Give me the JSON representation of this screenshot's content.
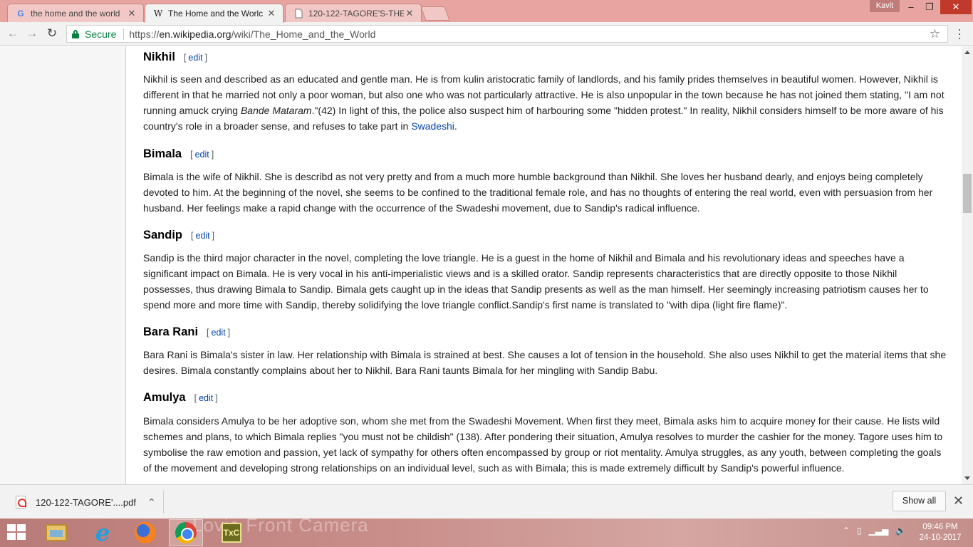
{
  "browser": {
    "tabs": [
      {
        "title": "the home and the world",
        "icon": "google-icon",
        "active": false
      },
      {
        "title": "The Home and the Worlc",
        "icon": "wikipedia-icon",
        "active": true
      },
      {
        "title": "120-122-TAGORE'S-THE-",
        "icon": "document-icon",
        "active": false
      }
    ],
    "user_name": "Kavit",
    "window_controls": {
      "minimize": "–",
      "restore": "❐",
      "close": "✕"
    },
    "nav": {
      "back": "←",
      "forward": "→",
      "reload": "↻"
    },
    "address": {
      "secure_label": "Secure",
      "scheme": "https://",
      "host": "en.wikipedia.org",
      "path": "/wiki/The_Home_and_the_World"
    }
  },
  "article": {
    "edit_label": "edit",
    "sections": [
      {
        "heading": "Nikhil",
        "paragraph": {
          "t1": "Nikhil is seen and described as an educated and gentle man. He is from kulin aristocratic family of landlords, and his family prides themselves in beautiful women. However, Nikhil is different in that he married not only a poor woman, but also one who was not particularly attractive. He is also unpopular in the town because he has not joined them stating, \"I am not running amuck crying ",
          "italic": "Bande Mataram",
          "t2": ".\"(42) In light of this, the police also suspect him of harbouring some \"hidden protest.\" In reality, Nikhil considers himself to be more aware of his country's role in a broader sense, and refuses to take part in ",
          "link": "Swadeshi",
          "t3": "."
        }
      },
      {
        "heading": "Bimala",
        "paragraph": "Bimala is the wife of Nikhil. She is describd as not very pretty and from a much more humble background than Nikhil. She loves her husband dearly, and enjoys being completely devoted to him. At the beginning of the novel, she seems to be confined to the traditional female role, and has no thoughts of entering the real world, even with persuasion from her husband. Her feelings make a rapid change with the occurrence of the Swadeshi movement, due to Sandip's radical influence."
      },
      {
        "heading": "Sandip",
        "paragraph": "Sandip is the third major character in the novel, completing the love triangle. He is a guest in the home of Nikhil and Bimala and his revolutionary ideas and speeches have a significant impact on Bimala. He is very vocal in his anti-imperialistic views and is a skilled orator. Sandip represents characteristics that are directly opposite to those Nikhil possesses, thus drawing Bimala to Sandip. Bimala gets caught up in the ideas that Sandip presents as well as the man himself. Her seemingly increasing patriotism causes her to spend more and more time with Sandip, thereby solidifying the love triangle conflict.Sandip's first name is translated to \"with dipa (light fire flame)\"."
      },
      {
        "heading": "Bara Rani",
        "paragraph": "Bara Rani is Bimala's sister in law. Her relationship with Bimala is strained at best. She causes a lot of tension in the household. She also uses Nikhil to get the material items that she desires. Bimala constantly complains about her to Nikhil. Bara Rani taunts Bimala for her mingling with Sandip Babu."
      },
      {
        "heading": "Amulya",
        "paragraph": "Bimala considers Amulya to be her adoptive son, whom she met from the Swadeshi Movement. When first they meet, Bimala asks him to acquire money for their cause. He lists wild schemes and plans, to which Bimala replies \"you must not be childish\" (138). After pondering their situation, Amulya resolves to murder the cashier for the money. Tagore uses him to symbolise the raw emotion and passion, yet lack of sympathy for others often encompassed by group or riot mentality. Amulya struggles, as any youth, between completing the goals of the movement and developing strong relationships on an individual level, such as with Bimala; this is made extremely difficult by Sandip's powerful influence."
      }
    ]
  },
  "downloads": {
    "file_name": "120-122-TAGORE'....pdf",
    "show_all_label": "Show all"
  },
  "taskbar": {
    "wallpaper_text": "Lovie Front Camera",
    "time": "09:46 PM",
    "date": "24-10-2017",
    "apps": [
      "file-explorer-icon",
      "internet-explorer-icon",
      "firefox-icon",
      "chrome-icon",
      "txc-icon"
    ],
    "txc_label": "TxC"
  },
  "colors": {
    "titlebar": "#e8a4a0",
    "link": "#0645ad",
    "secure": "#0b8043"
  }
}
